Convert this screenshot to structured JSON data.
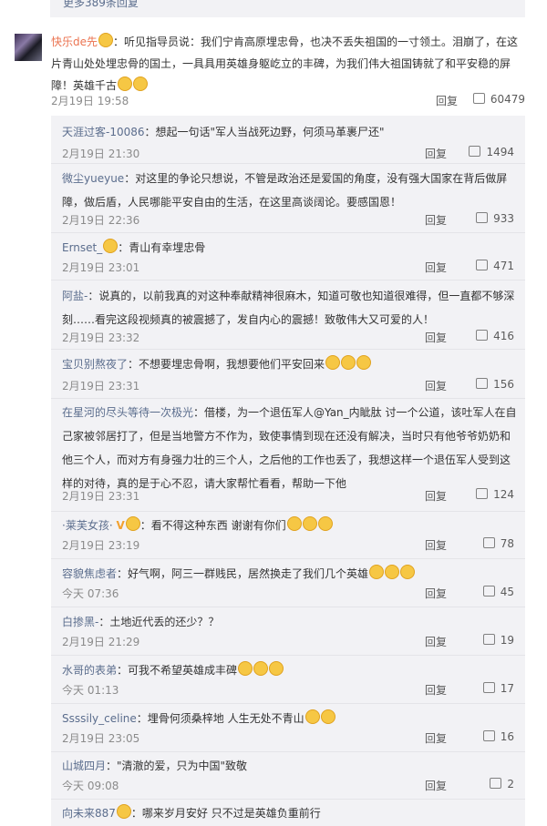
{
  "top_more": "更多389条回复",
  "main": {
    "user": "快乐de先",
    "text": "：听见指导员说：我们宁肯高原埋忠骨，也决不丢失祖国的一寸领土。泪崩了，在这片青山处处埋忠骨的国土，一具具用英雄身躯屹立的丰碑，为我们伟大祖国铸就了和平安稳的屏障！英雄千古",
    "time": "2月19日 19:58",
    "reply": "回复",
    "likes": "60479"
  },
  "replies": [
    {
      "user": "天涯过客-10086",
      "text": "：想起一句话\"军人当战死边野，何须马革裹尸还\"",
      "time": "2月19日 21:30",
      "reply": "回复",
      "likes": "1494"
    },
    {
      "user": "微尘yueyue",
      "text": "：对这里的争论只想说，不管是政治还是爱国的角度，没有强大国家在背后做屏障，做后盾，人民哪能平安自由的生活，在这里高谈阔论。要感国恩！",
      "time": "2月19日 22:36",
      "reply": "回复",
      "likes": "933"
    },
    {
      "user": "Ernset_",
      "text": "：青山有幸埋忠骨",
      "time": "2月19日 23:01",
      "reply": "回复",
      "likes": "471"
    },
    {
      "user": "阿盐-",
      "text": "：说真的，以前我真的对这种奉献精神很麻木，知道可敬也知道很难得，但一直都不够深刻……看完这段视频真的被震撼了，发自内心的震撼！致敬伟大又可爱的人！",
      "time": "2月19日 23:32",
      "reply": "回复",
      "likes": "416"
    },
    {
      "user": "宝贝别熬夜了",
      "text": "：不想要埋忠骨啊，我想要他们平安回来",
      "time": "2月19日 23:31",
      "reply": "回复",
      "likes": "156"
    },
    {
      "user": "在星河的尽头等待一次极光",
      "text": "：借楼，为一个退伍军人@Yan_内眦肽 讨一个公道，该吐军人在自己家被邻居打了，但是当地警方不作为，致使事情到现在还没有解决，当时只有他爷爷奶奶和他三个人，而对方有身强力壮的三个人，之后他的工作也丢了，我想这样一个退伍军人受到这样的对待，真的是于心不忍，请大家帮忙看看，帮助一下他",
      "time": "2月19日 23:31",
      "reply": "回复",
      "likes": "124"
    },
    {
      "user": "·莱芙女孩·",
      "text": "：看不得这种东西 谢谢有你们",
      "time": "2月19日 23:19",
      "reply": "回复",
      "likes": "78"
    },
    {
      "user": "容貌焦虑者",
      "text": "：好气啊，阿三一群贱民，居然换走了我们几个英雄",
      "time": "今天 07:36",
      "reply": "回复",
      "likes": "45"
    },
    {
      "user": "白掺黑-",
      "text": "：土地近代丢的还少？？",
      "time": "2月19日 21:29",
      "reply": "回复",
      "likes": "19"
    },
    {
      "user": "水哥的表弟",
      "text": "：可我不希望英雄成丰碑",
      "time": "今天 01:13",
      "reply": "回复",
      "likes": "17"
    },
    {
      "user": "Ssssily_celine",
      "text": "：埋骨何须桑梓地 人生无处不青山",
      "time": "2月19日 23:05",
      "reply": "回复",
      "likes": "16"
    },
    {
      "user": "山城四月",
      "text": "：\"清澈的爱，只为中国\"致敬",
      "time": "今天 09:08",
      "reply": "回复",
      "likes": "2"
    },
    {
      "user": "向未来887",
      "text": "：哪来岁月安好 只不过是英雄负重前行",
      "time": "",
      "reply": "",
      "likes": ""
    }
  ]
}
